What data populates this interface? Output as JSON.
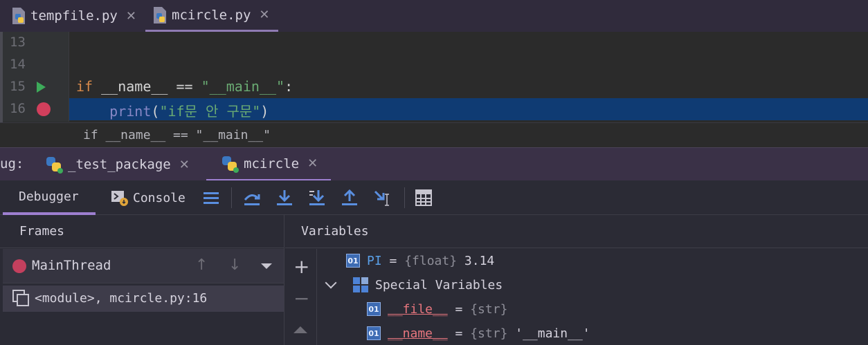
{
  "editor_tabs": [
    {
      "label": "tempfile.py",
      "close": "✕",
      "icon": "python-file-icon"
    },
    {
      "label": "mcircle.py",
      "close": "✕",
      "icon": "python-file-icon"
    }
  ],
  "editor": {
    "lines": [
      {
        "number": "13"
      },
      {
        "number": "14"
      },
      {
        "number": "15",
        "keyword": "if",
        "cond_a": " __name__ == ",
        "str": "\"__main__\"",
        "tail": ":"
      },
      {
        "number": "16",
        "indent": "    ",
        "builtin": "print",
        "open": "(",
        "str": "\"if문 안 구문\"",
        "close": ")"
      }
    ],
    "breadcrumb": "if __name__ == \"__main__\""
  },
  "debug": {
    "label": "ug:",
    "tabs": [
      {
        "label": "_test_package",
        "close": "✕",
        "icon": "python-run-icon"
      },
      {
        "label": "mcircle",
        "close": "✕",
        "icon": "python-run-icon"
      }
    ]
  },
  "toolbar": {
    "debugger_label": "Debugger",
    "console_label": "Console",
    "icons": [
      "menu-icon",
      "step-over-icon",
      "step-into-icon",
      "step-into-my-code-icon",
      "step-out-icon",
      "run-to-cursor-icon",
      "evaluate-expression-icon"
    ]
  },
  "frames": {
    "title": "Frames",
    "thread": "MainThread",
    "up_arrow": "↑",
    "down_arrow": "↓",
    "items": [
      {
        "label": "<module>, mcircle.py:16"
      }
    ]
  },
  "variables": {
    "title": "Variables",
    "add": "+",
    "remove": "−",
    "items": [
      {
        "name": "PI",
        "eq": " = ",
        "type": "{float}",
        "value": " 3.14"
      },
      {
        "group": "Special Variables"
      },
      {
        "name": "__file__",
        "eq": " = ",
        "type": "{str}",
        "value": ""
      },
      {
        "name": "__name__",
        "eq": " = ",
        "type": "{str}",
        "value": " '__main__'"
      }
    ]
  }
}
